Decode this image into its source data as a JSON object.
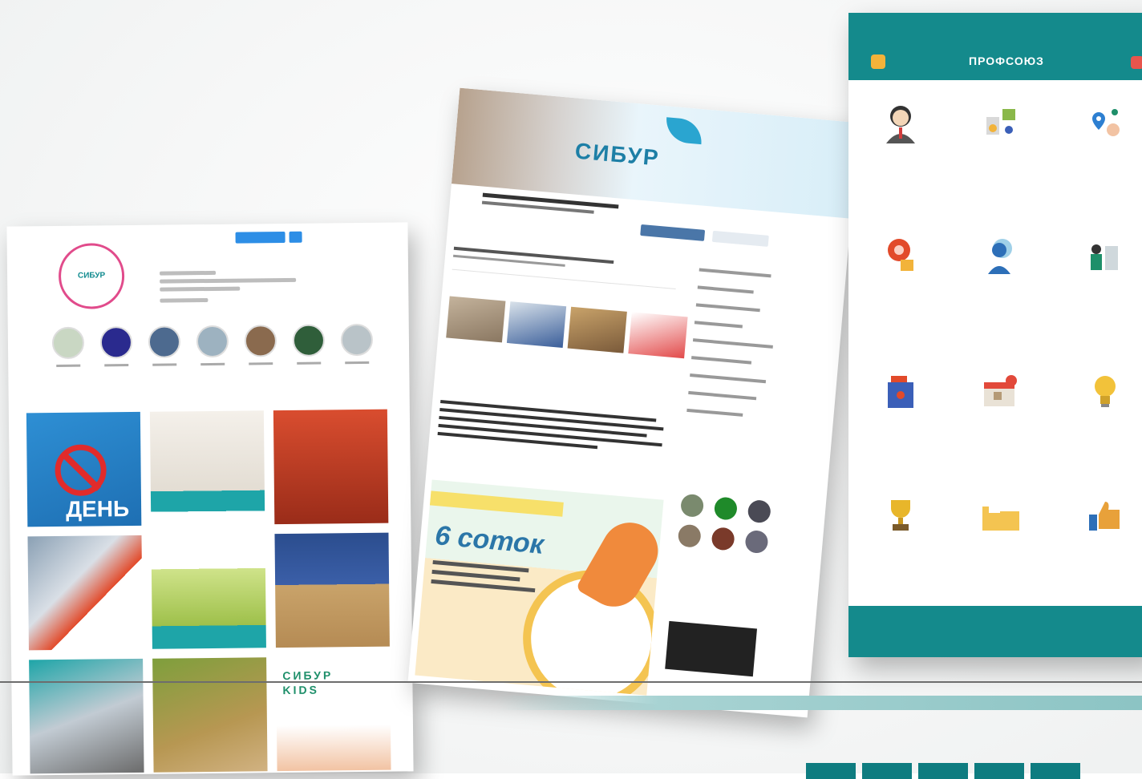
{
  "page": {
    "caption": ""
  },
  "instagram": {
    "avatar_text": "СИБУР",
    "username": "",
    "follow_label": "",
    "stats": [
      "",
      "",
      ""
    ],
    "stories": [
      {
        "color": "#c9d7c3"
      },
      {
        "color": "#2a2a8e"
      },
      {
        "color": "#4d6a8f"
      },
      {
        "color": "#9db2c0"
      },
      {
        "color": "#8a6a4e"
      },
      {
        "color": "#2f5e3a"
      },
      {
        "color": "#b9c3c8"
      }
    ],
    "tabs": [
      "",
      "",
      ""
    ],
    "posts": [
      {
        "kind": "p1",
        "text": "ДЕНЬ"
      },
      {
        "kind": "p2",
        "text": ""
      },
      {
        "kind": "p3",
        "text": ""
      },
      {
        "kind": "p4",
        "text": ""
      },
      {
        "kind": "p5",
        "text": ""
      },
      {
        "kind": "p6",
        "text": ""
      },
      {
        "kind": "p7",
        "text": ""
      },
      {
        "kind": "p8",
        "text": ""
      },
      {
        "kind": "p9",
        "text": "СИБУР KIDS"
      }
    ]
  },
  "vk": {
    "banner_title": "СИБУР",
    "promo_big": "6 соток",
    "promo_quotes": [
      "",
      "",
      ""
    ]
  },
  "app": {
    "time": "",
    "title": "ПРОФСОЮЗ",
    "footer": "",
    "tiles": [
      {
        "icon": "person-headset-icon",
        "color": "#333",
        "label": ""
      },
      {
        "icon": "documents-icon",
        "color": "#8ab84a",
        "label": ""
      },
      {
        "icon": "map-pin-icon",
        "color": "#2d7fd1",
        "label": ""
      },
      {
        "icon": "gift-badge-icon",
        "color": "#e24a2a",
        "label": ""
      },
      {
        "icon": "user-search-icon",
        "color": "#2d6fb8",
        "label": ""
      },
      {
        "icon": "people-icon",
        "color": "#1e8f6a",
        "label": ""
      },
      {
        "icon": "ballot-box-icon",
        "color": "#3b5fb8",
        "label": ""
      },
      {
        "icon": "calendar-icon",
        "color": "#e2493a",
        "label": ""
      },
      {
        "icon": "lightbulb-icon",
        "color": "#f2c23a",
        "label": ""
      },
      {
        "icon": "trophy-icon",
        "color": "#e8b62a",
        "label": ""
      },
      {
        "icon": "folder-icon",
        "color": "#f4c451",
        "label": ""
      },
      {
        "icon": "thumbs-up-icon",
        "color": "#e8a13a",
        "label": ""
      }
    ]
  }
}
